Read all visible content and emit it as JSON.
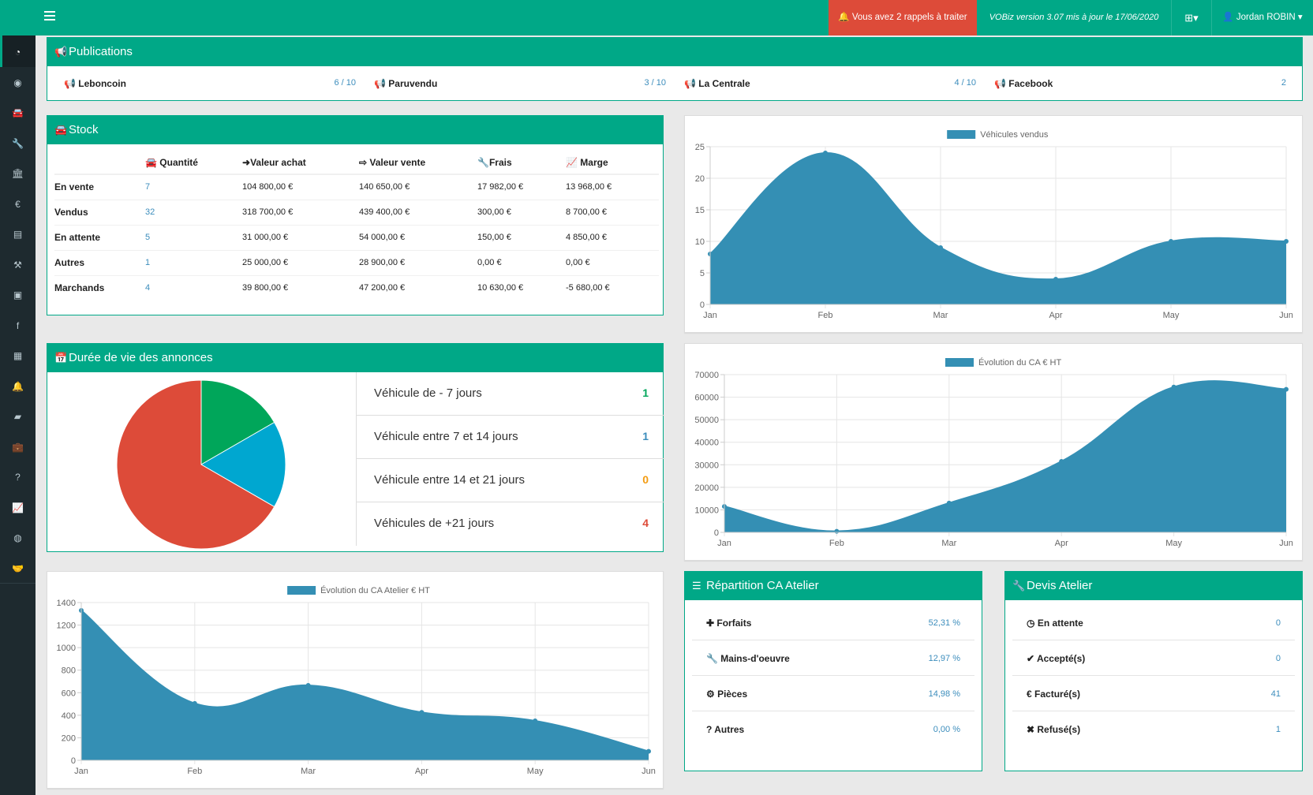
{
  "topbar": {
    "alert": "🔔 Vous avez 2 rappels à traiter",
    "version": "VOBiz version 3.07 mis à jour le 17/06/2020",
    "plus_icon": "plus-square-icon",
    "user": "Jordan ROBIN ▾"
  },
  "sidebar": {
    "icons": [
      "dashboard-icon",
      "user-circle-icon",
      "car-icon",
      "wrench-icon",
      "bank-icon",
      "euro-icon",
      "file-icon",
      "gavel-icon",
      "contact-icon",
      "facebook-icon",
      "calendar-icon",
      "bell-icon",
      "sticky-note-icon",
      "briefcase-icon",
      "question-icon",
      "line-chart-icon",
      "globe-icon",
      "handshake-icon"
    ]
  },
  "publications": {
    "title": "Publications",
    "items": [
      {
        "label": "Leboncoin",
        "value": "6 / 10"
      },
      {
        "label": "Paruvendu",
        "value": "3 / 10"
      },
      {
        "label": "La Centrale",
        "value": "4 / 10"
      },
      {
        "label": "Facebook",
        "value": "2"
      }
    ]
  },
  "stock": {
    "title": "Stock",
    "headers": [
      "Quantité",
      "Valeur achat",
      "Valeur vente",
      "Frais",
      "Marge"
    ],
    "rows": [
      {
        "label": "En vente",
        "qty": "7",
        "achat": "104 800,00 €",
        "vente": "140 650,00 €",
        "frais": "17 982,00 €",
        "marge": "13 968,00 €"
      },
      {
        "label": "Vendus",
        "qty": "32",
        "achat": "318 700,00 €",
        "vente": "439 400,00 €",
        "frais": "300,00 €",
        "marge": "8 700,00 €"
      },
      {
        "label": "En attente",
        "qty": "5",
        "achat": "31 000,00 €",
        "vente": "54 000,00 €",
        "frais": "150,00 €",
        "marge": "4 850,00 €"
      },
      {
        "label": "Autres",
        "qty": "1",
        "achat": "25 000,00 €",
        "vente": "28 900,00 €",
        "frais": "0,00 €",
        "marge": "0,00 €"
      },
      {
        "label": "Marchands",
        "qty": "4",
        "achat": "39 800,00 €",
        "vente": "47 200,00 €",
        "frais": "10 630,00 €",
        "marge": "-5 680,00 €"
      }
    ]
  },
  "duree": {
    "title": "Durée de vie des annonces",
    "items": [
      {
        "label": "Véhicule de - 7 jours",
        "value": "1",
        "color": "#00a65a"
      },
      {
        "label": "Véhicule entre 7 et 14 jours",
        "value": "1",
        "color": "#3c8dbc"
      },
      {
        "label": "Véhicule entre 14 et 21 jours",
        "value": "0",
        "color": "#f39c12"
      },
      {
        "label": "Véhicules de +21 jours",
        "value": "4",
        "color": "#dd4b39"
      }
    ]
  },
  "repartition": {
    "title": "Répartition CA Atelier",
    "items": [
      {
        "icon": "plus-icon",
        "glyph": "✚",
        "label": "Forfaits",
        "value": "52,31 %"
      },
      {
        "icon": "wrench-icon",
        "glyph": "🔧",
        "label": "Mains-d'oeuvre",
        "value": "12,97 %"
      },
      {
        "icon": "cogs-icon",
        "glyph": "⚙",
        "label": "Pièces",
        "value": "14,98 %"
      },
      {
        "icon": "question-icon",
        "glyph": "?",
        "label": "Autres",
        "value": "0,00 %"
      }
    ]
  },
  "devis": {
    "title": "Devis Atelier",
    "items": [
      {
        "icon": "clock-icon",
        "glyph": "◷",
        "label": "En attente",
        "value": "0"
      },
      {
        "icon": "check-icon",
        "glyph": "✔",
        "label": "Accepté(s)",
        "value": "0"
      },
      {
        "icon": "euro-icon",
        "glyph": "€",
        "label": "Facturé(s)",
        "value": "41"
      },
      {
        "icon": "times-icon",
        "glyph": "✖",
        "label": "Refusé(s)",
        "value": "1"
      }
    ]
  },
  "colors": {
    "brand": "#00a887",
    "series": "#348fb4",
    "danger": "#dd4b39",
    "link": "#3c8dbc"
  },
  "chart_data": [
    {
      "type": "area",
      "series": [
        {
          "name": "Véhicules vendus",
          "values": [
            8,
            24,
            9,
            4,
            10,
            10
          ]
        }
      ],
      "categories": [
        "Jan",
        "Feb",
        "Mar",
        "Apr",
        "May",
        "Jun"
      ],
      "ylim": [
        0,
        25
      ],
      "yticks": [
        0,
        5,
        10,
        15,
        20,
        25
      ],
      "legend": "top"
    },
    {
      "type": "area",
      "series": [
        {
          "name": "Évolution du CA € HT",
          "values": [
            11500,
            500,
            13000,
            31500,
            64500,
            63500
          ]
        }
      ],
      "categories": [
        "Jan",
        "Feb",
        "Mar",
        "Apr",
        "May",
        "Jun"
      ],
      "ylim": [
        0,
        70000
      ],
      "yticks": [
        0,
        10000,
        20000,
        30000,
        40000,
        50000,
        60000,
        70000
      ],
      "legend": "top"
    },
    {
      "type": "area",
      "series": [
        {
          "name": "Évolution du CA Atelier € HT",
          "values": [
            1330,
            505,
            665,
            425,
            350,
            80
          ]
        }
      ],
      "categories": [
        "Jan",
        "Feb",
        "Mar",
        "Apr",
        "May",
        "Jun"
      ],
      "ylim": [
        0,
        1400
      ],
      "yticks": [
        0,
        200,
        400,
        600,
        800,
        1000,
        1200,
        1400
      ],
      "legend": "top"
    },
    {
      "type": "pie",
      "categories": [
        "Véhicule de - 7 jours",
        "Véhicule entre 7 et 14 jours",
        "Véhicule entre 14 et 21 jours",
        "Véhicules de +21 jours"
      ],
      "values": [
        1,
        1,
        0,
        4
      ],
      "colors": [
        "#00a65a",
        "#00a7d0",
        "#f39c12",
        "#dd4b39"
      ]
    }
  ]
}
